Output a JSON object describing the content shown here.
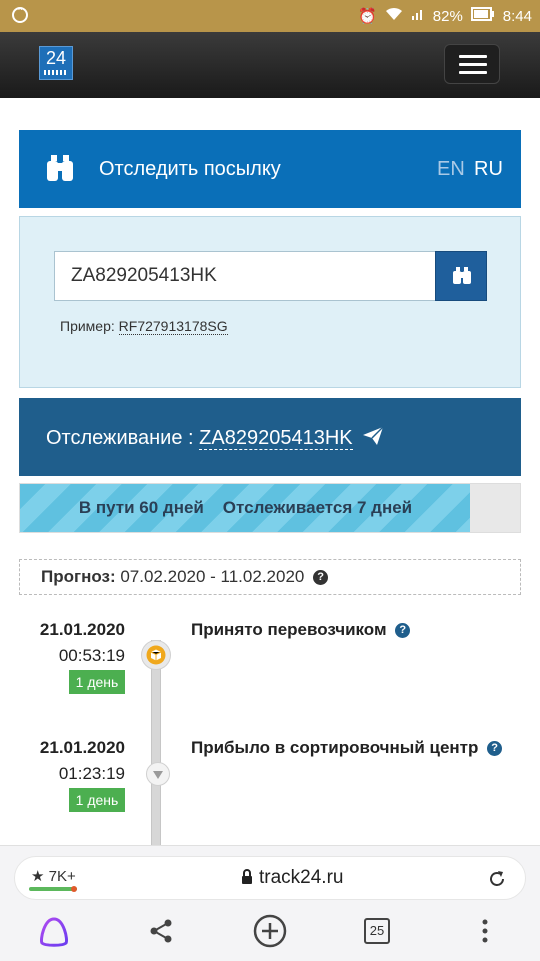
{
  "status_bar": {
    "battery": "82%",
    "time": "8:44"
  },
  "track_panel": {
    "title": "Отследить посылку",
    "lang_en": "EN",
    "lang_ru": "RU",
    "search_value": "ZA829205413HK",
    "example_label": "Пример:",
    "example_code": "RF727913178SG"
  },
  "tracking": {
    "label": "Отслеживание :",
    "code": "ZA829205413HK"
  },
  "progress": {
    "in_transit": "В пути 60 дней",
    "tracked": "Отслеживается 7 дней",
    "fill_fraction": 0.9
  },
  "forecast": {
    "label": "Прогноз:",
    "value": "07.02.2020 - 11.02.2020"
  },
  "events": [
    {
      "date": "21.01.2020",
      "time": "00:53:19",
      "badge": "1 день",
      "status": "Принято перевозчиком"
    },
    {
      "date": "21.01.2020",
      "time": "01:23:19",
      "badge": "1 день",
      "status": "Прибыло в сортировочный центр"
    }
  ],
  "browser": {
    "rating": "7K+",
    "url": "track24.ru",
    "tabs_count": "25"
  },
  "colors": {
    "status_bar": "#b8954a",
    "track_header": "#0a6fb8",
    "tracking_bar": "#1f5e8c",
    "badge_green": "#4caf50"
  }
}
